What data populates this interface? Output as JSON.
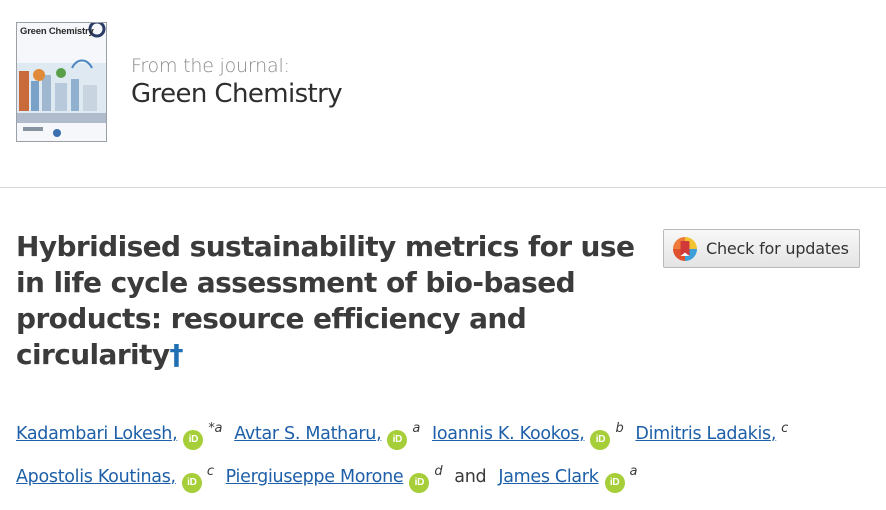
{
  "journal": {
    "cover_title": "Green Chemistry",
    "from_label": "From the journal:",
    "name": "Green Chemistry"
  },
  "article": {
    "title": "Hybridised sustainability metrics for use in life cycle assessment of bio-based products: resource efficiency and circularity",
    "title_mark": "†"
  },
  "check_updates": {
    "label": "Check for updates"
  },
  "authors": [
    {
      "name": "Kadambari Lokesh",
      "orcid": true,
      "sup": "*a"
    },
    {
      "name": "Avtar S. Matharu",
      "orcid": true,
      "sup": "a"
    },
    {
      "name": "Ioannis K. Kookos",
      "orcid": true,
      "sup": "b"
    },
    {
      "name": "Dimitris Ladakis",
      "orcid": false,
      "sup": "c"
    },
    {
      "name": "Apostolis Koutinas",
      "orcid": true,
      "sup": "c"
    },
    {
      "name": "Piergiuseppe Morone",
      "orcid": true,
      "sup": "d"
    },
    {
      "name": "James Clark",
      "orcid": true,
      "sup": "a"
    }
  ],
  "author_separator": ",",
  "author_conjunction": "and",
  "orcid_icon_text": "iD",
  "colors": {
    "link": "#1d5fa8",
    "orcid": "#a6ce39",
    "dagger": "#1f6fb2"
  },
  "icons": [
    "orcid-icon",
    "crossmark-icon",
    "journal-cover-image"
  ]
}
